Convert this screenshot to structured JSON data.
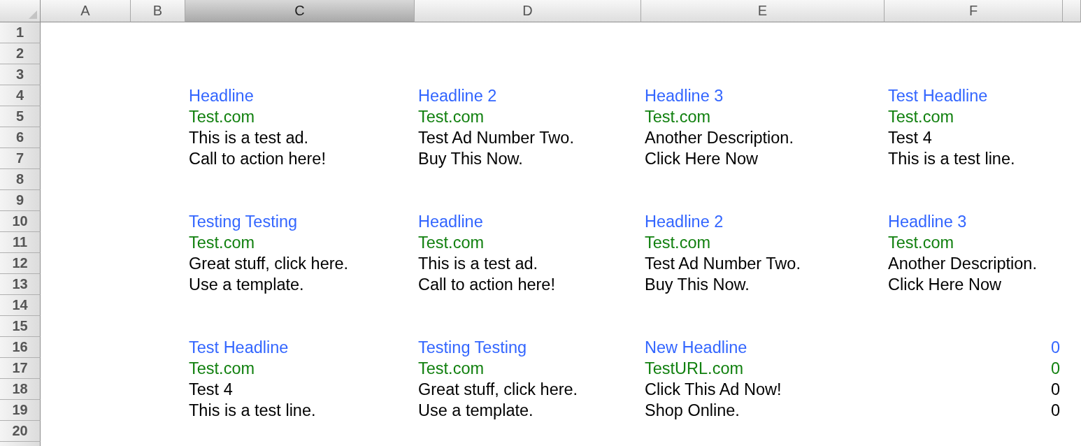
{
  "sheet": {
    "columns": [
      {
        "label": "A",
        "selected": false
      },
      {
        "label": "B",
        "selected": false
      },
      {
        "label": "C",
        "selected": true
      },
      {
        "label": "D",
        "selected": false
      },
      {
        "label": "E",
        "selected": false
      },
      {
        "label": "F",
        "selected": false
      }
    ],
    "rows": [
      {
        "label": "1"
      },
      {
        "label": "2"
      },
      {
        "label": "3"
      },
      {
        "label": "4",
        "cells": [
          {
            "kind": "text",
            "text": "Headline",
            "color": "#3366ff"
          },
          {
            "kind": "text",
            "text": "Headline 2",
            "color": "#3366ff"
          },
          {
            "kind": "text",
            "text": "Headline 3",
            "color": "#3366ff"
          },
          {
            "kind": "text",
            "text": "Test Headline",
            "color": "#3366ff"
          }
        ]
      },
      {
        "label": "5",
        "cells": [
          {
            "kind": "text",
            "text": "Test.com",
            "color": "#11800f"
          },
          {
            "kind": "text",
            "text": "Test.com",
            "color": "#11800f"
          },
          {
            "kind": "text",
            "text": "Test.com",
            "color": "#11800f"
          },
          {
            "kind": "text",
            "text": "Test.com",
            "color": "#11800f"
          }
        ]
      },
      {
        "label": "6",
        "cells": [
          {
            "kind": "text",
            "text": "This is a test ad.",
            "color": "#000000"
          },
          {
            "kind": "text",
            "text": "Test Ad Number Two.",
            "color": "#000000"
          },
          {
            "kind": "text",
            "text": "Another Description.",
            "color": "#000000"
          },
          {
            "kind": "text",
            "text": "Test 4",
            "color": "#000000"
          }
        ]
      },
      {
        "label": "7",
        "cells": [
          {
            "kind": "text",
            "text": "Call to action here!",
            "color": "#000000"
          },
          {
            "kind": "text",
            "text": "Buy This Now.",
            "color": "#000000"
          },
          {
            "kind": "text",
            "text": "Click Here Now",
            "color": "#000000"
          },
          {
            "kind": "text",
            "text": "This is a test line.",
            "color": "#000000"
          }
        ]
      },
      {
        "label": "8"
      },
      {
        "label": "9"
      },
      {
        "label": "10",
        "cells": [
          {
            "kind": "text",
            "text": "Testing Testing",
            "color": "#3366ff"
          },
          {
            "kind": "text",
            "text": "Headline",
            "color": "#3366ff"
          },
          {
            "kind": "text",
            "text": "Headline 2",
            "color": "#3366ff"
          },
          {
            "kind": "text",
            "text": "Headline 3",
            "color": "#3366ff"
          }
        ]
      },
      {
        "label": "11",
        "cells": [
          {
            "kind": "text",
            "text": "Test.com",
            "color": "#11800f"
          },
          {
            "kind": "text",
            "text": "Test.com",
            "color": "#11800f"
          },
          {
            "kind": "text",
            "text": "Test.com",
            "color": "#11800f"
          },
          {
            "kind": "text",
            "text": "Test.com",
            "color": "#11800f"
          }
        ]
      },
      {
        "label": "12",
        "cells": [
          {
            "kind": "text",
            "text": "Great stuff, click here.",
            "color": "#000000"
          },
          {
            "kind": "text",
            "text": "This is a test ad.",
            "color": "#000000"
          },
          {
            "kind": "text",
            "text": "Test Ad Number Two.",
            "color": "#000000"
          },
          {
            "kind": "text",
            "text": "Another Description.",
            "color": "#000000"
          }
        ]
      },
      {
        "label": "13",
        "cells": [
          {
            "kind": "text",
            "text": "Use a template.",
            "color": "#000000"
          },
          {
            "kind": "text",
            "text": "Call to action here!",
            "color": "#000000"
          },
          {
            "kind": "text",
            "text": "Buy This Now.",
            "color": "#000000"
          },
          {
            "kind": "text",
            "text": "Click Here Now",
            "color": "#000000"
          }
        ]
      },
      {
        "label": "14"
      },
      {
        "label": "15"
      },
      {
        "label": "16",
        "cells": [
          {
            "kind": "text",
            "text": "Test Headline",
            "color": "#3366ff"
          },
          {
            "kind": "text",
            "text": "Testing Testing",
            "color": "#3366ff"
          },
          {
            "kind": "text",
            "text": "New Headline",
            "color": "#3366ff"
          },
          {
            "kind": "number",
            "text": "0",
            "color": "#3366ff"
          }
        ]
      },
      {
        "label": "17",
        "cells": [
          {
            "kind": "text",
            "text": "Test.com",
            "color": "#11800f"
          },
          {
            "kind": "text",
            "text": "Test.com",
            "color": "#11800f"
          },
          {
            "kind": "text",
            "text": "TestURL.com",
            "color": "#11800f"
          },
          {
            "kind": "number",
            "text": "0",
            "color": "#11800f"
          }
        ]
      },
      {
        "label": "18",
        "cells": [
          {
            "kind": "text",
            "text": "Test 4",
            "color": "#000000"
          },
          {
            "kind": "text",
            "text": "Great stuff, click here.",
            "color": "#000000"
          },
          {
            "kind": "text",
            "text": "Click This Ad Now!",
            "color": "#000000"
          },
          {
            "kind": "number",
            "text": "0",
            "color": "#000000"
          }
        ]
      },
      {
        "label": "19",
        "cells": [
          {
            "kind": "text",
            "text": "This is a test line.",
            "color": "#000000"
          },
          {
            "kind": "text",
            "text": "Use a template.",
            "color": "#000000"
          },
          {
            "kind": "text",
            "text": "Shop Online.",
            "color": "#000000"
          },
          {
            "kind": "number",
            "text": "0",
            "color": "#000000"
          }
        ]
      },
      {
        "label": "20"
      }
    ]
  }
}
